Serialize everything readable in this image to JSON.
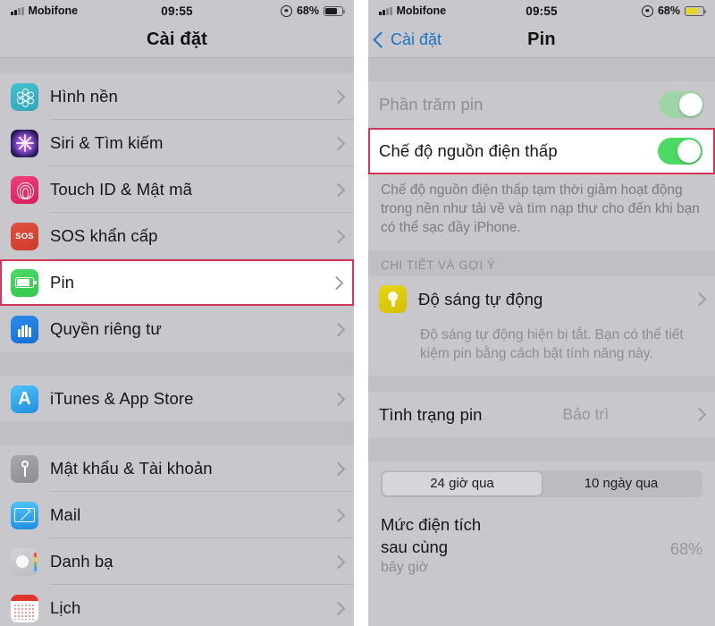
{
  "left": {
    "status_bar": {
      "carrier": "Mobifone",
      "time": "09:55",
      "battery_percent": "68%",
      "battery_color": "#1c1c1e"
    },
    "nav": {
      "title": "Cài đặt"
    },
    "groups": [
      {
        "items": [
          {
            "icon": "wallpaper-icon",
            "label": "Hình nền"
          },
          {
            "icon": "siri-icon",
            "label": "Siri & Tìm kiếm"
          },
          {
            "icon": "touchid-icon",
            "label": "Touch ID & Mật mã"
          },
          {
            "icon": "sos-icon",
            "label": "SOS khẩn cấp",
            "icon_text": "SOS"
          },
          {
            "icon": "battery-icon",
            "label": "Pin",
            "highlighted": true
          },
          {
            "icon": "privacy-hand-icon",
            "label": "Quyền riêng tư"
          }
        ]
      },
      {
        "items": [
          {
            "icon": "itunes-appstore-icon",
            "label": "iTunes & App Store",
            "icon_text": "A"
          }
        ]
      },
      {
        "items": [
          {
            "icon": "key-icon",
            "label": "Mật khẩu & Tài khoản"
          },
          {
            "icon": "mail-icon",
            "label": "Mail"
          },
          {
            "icon": "contacts-icon",
            "label": "Danh bạ"
          },
          {
            "icon": "calendar-icon",
            "label": "Lịch"
          }
        ]
      }
    ]
  },
  "right": {
    "status_bar": {
      "carrier": "Mobifone",
      "time": "09:55",
      "battery_percent": "68%",
      "battery_color": "#e8d627"
    },
    "nav": {
      "back_label": "Cài đặt",
      "title": "Pin"
    },
    "battery_percentage_row": {
      "label": "Phần trăm pin",
      "toggle_state": "on"
    },
    "low_power_row": {
      "label": "Chế độ nguồn điện thấp",
      "toggle_state": "on",
      "highlighted": true
    },
    "low_power_footnote": "Chế độ nguồn điện thấp tạm thời giảm hoạt động trong nền như tải về và tìm nạp thư cho đến khi bạn có thể sạc đầy iPhone.",
    "details_header": "CHI TIẾT VÀ GỢI Ý",
    "auto_brightness_row": {
      "icon": "lightbulb-icon",
      "label": "Độ sáng tự động"
    },
    "auto_brightness_note": "Độ sáng tự động hiện bị tắt. Bạn có thể tiết kiệm pin bằng cách bật tính năng này.",
    "battery_health_row": {
      "label": "Tình trạng pin",
      "value": "Bảo trì"
    },
    "segmented": {
      "options": [
        "24 giờ qua",
        "10 ngày qua"
      ],
      "selected_index": 0
    },
    "last_charge": {
      "title_line1": "Mức điện tích",
      "title_line2": "sau cùng",
      "value": "68%",
      "sub": "bây giờ"
    }
  },
  "accents": {
    "highlight_border": "#d5355a",
    "toggle_on": "#4cd964",
    "link_blue": "#1b73c4"
  }
}
